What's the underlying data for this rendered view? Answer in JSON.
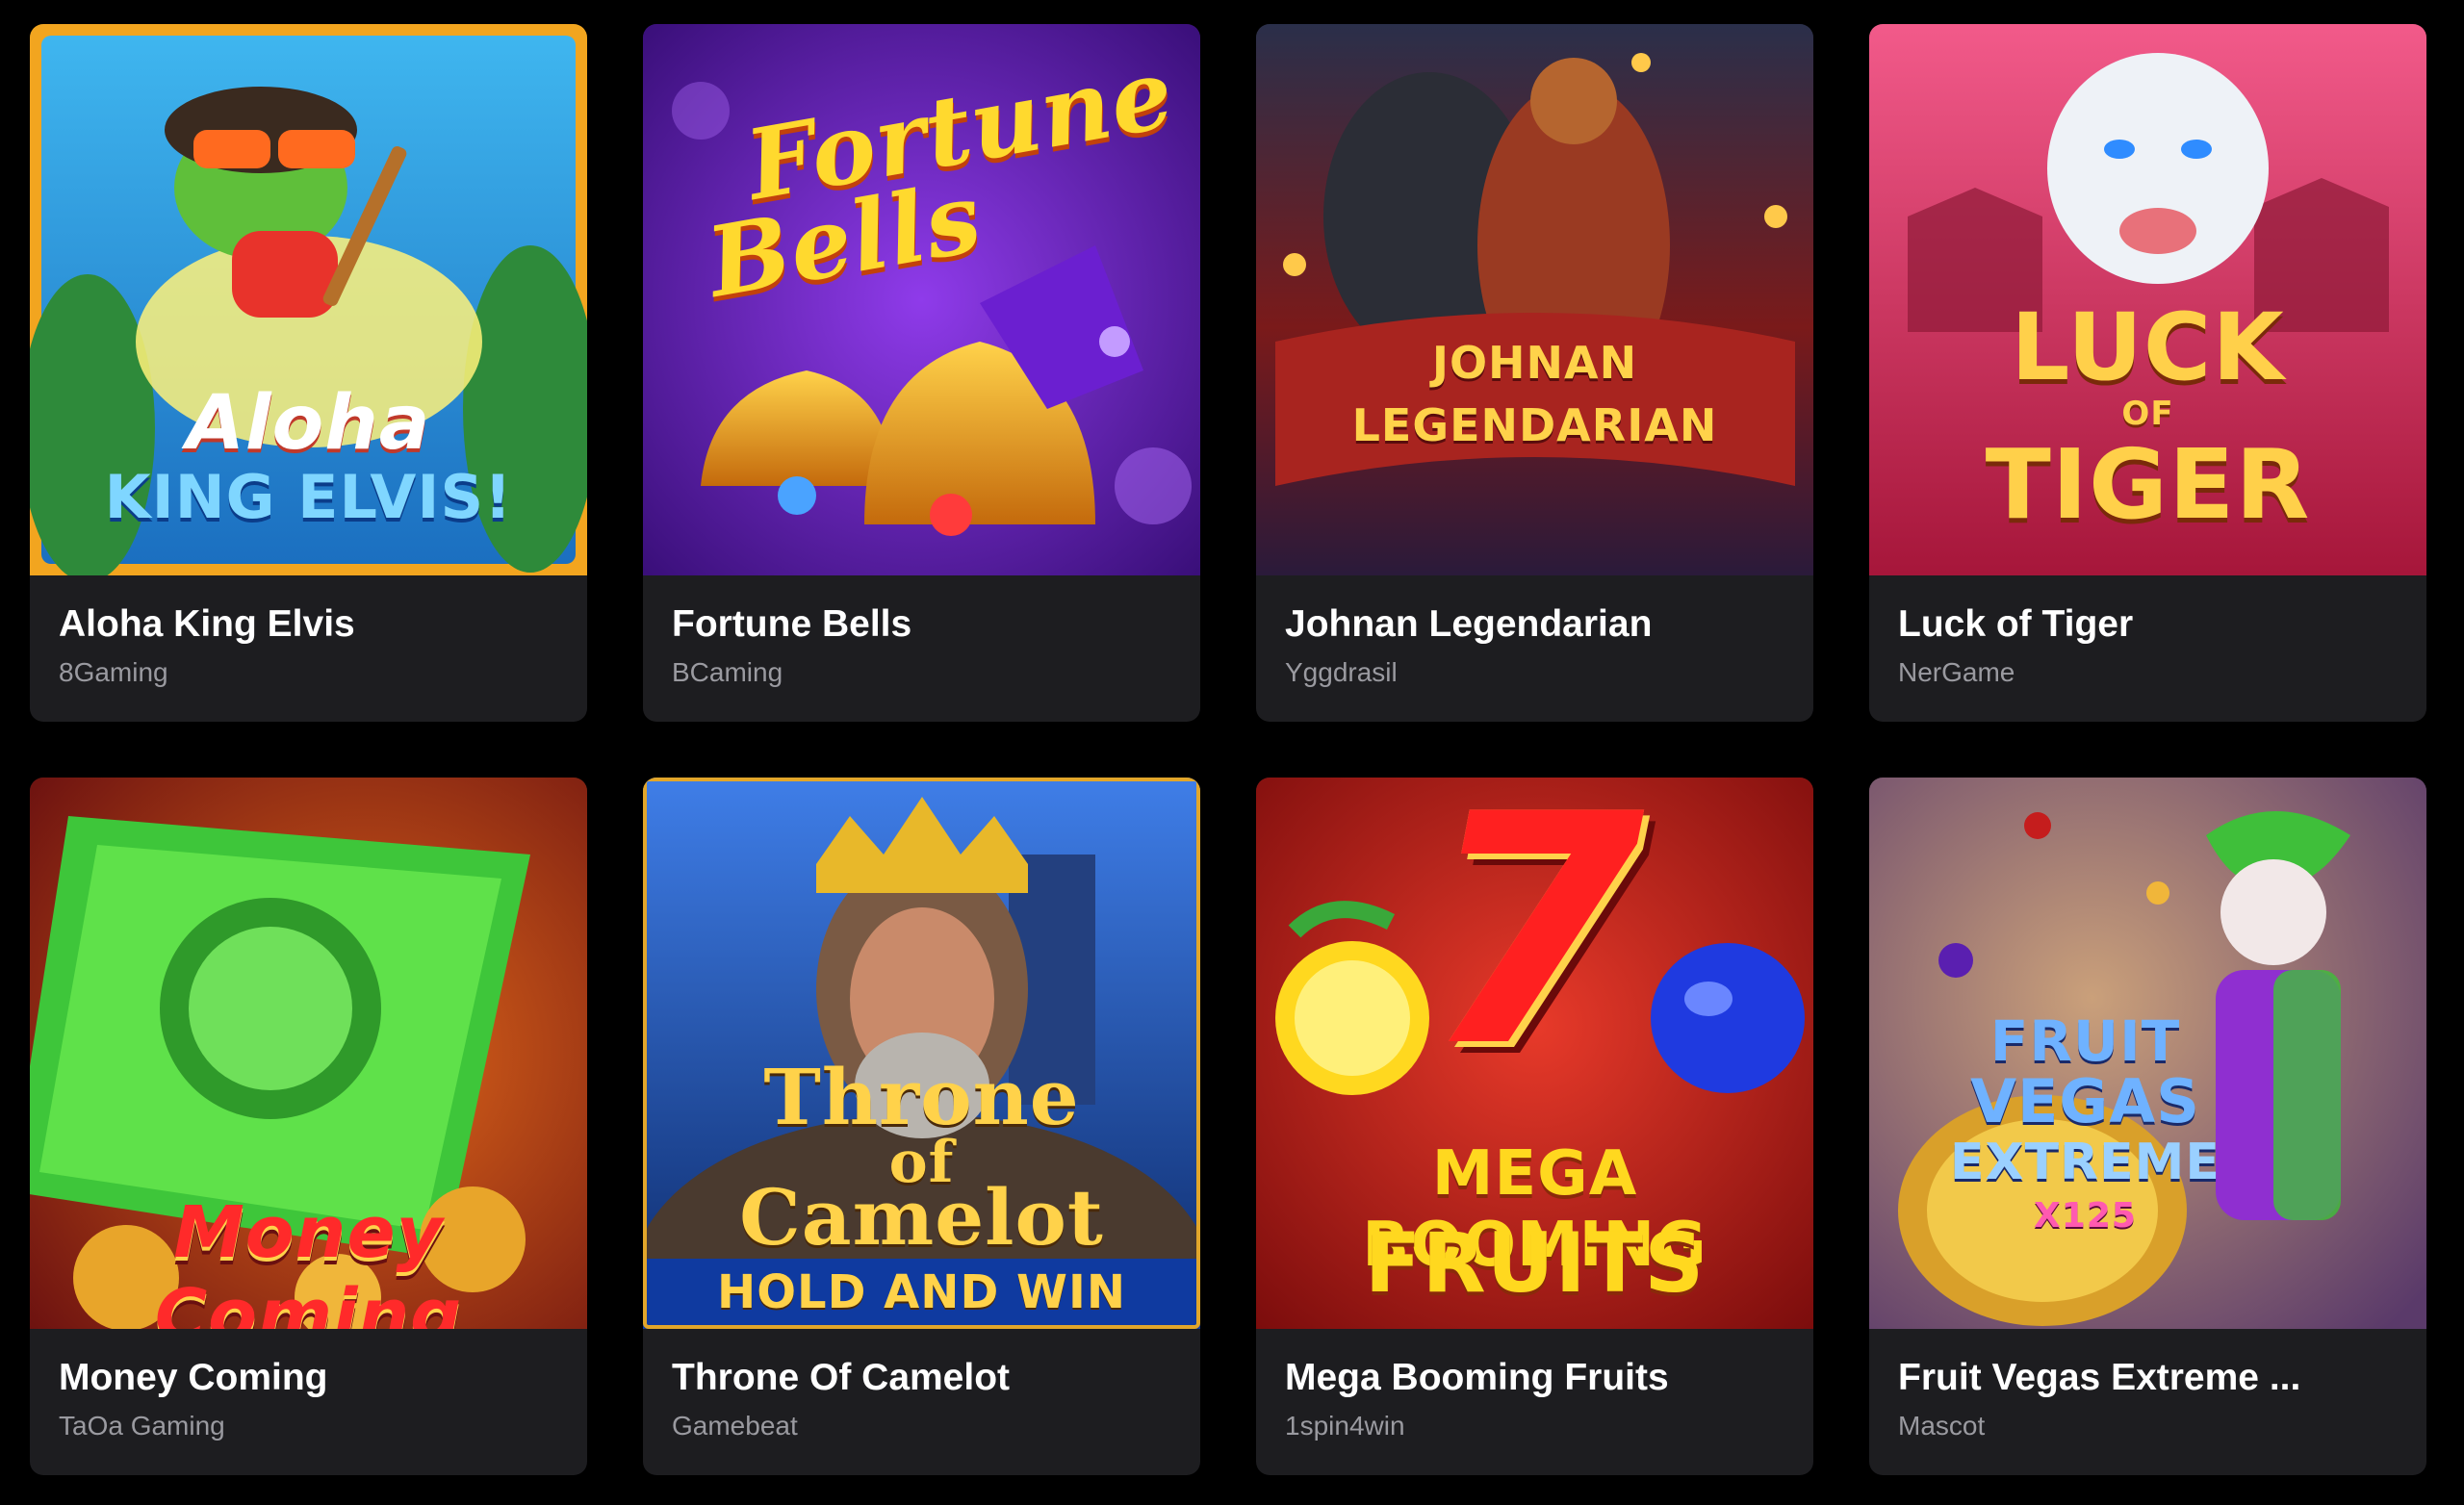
{
  "games": [
    {
      "title": "Aloha King Elvis",
      "provider": "8Gaming",
      "art_line1": "Aloha",
      "art_line2": "KING ELVIS!",
      "accent": "#2fa9e6",
      "icon": "frog-ukulele-icon"
    },
    {
      "title": "Fortune Bells",
      "provider": "BCaming",
      "art_line1": "Fortune",
      "art_line2": "Bells",
      "accent": "#7a2fd6",
      "icon": "bells-icon"
    },
    {
      "title": "Johnan Legendarian",
      "provider": "Yggdrasil",
      "art_line1": "JOHNAN",
      "art_line2": "LEGENDARIAN",
      "accent": "#b3261e",
      "icon": "warrior-icon"
    },
    {
      "title": "Luck of Tiger",
      "provider": "NerGame",
      "art_line1": "LUCK",
      "art_line2": "OF",
      "art_line3": "TIGER",
      "accent": "#d93158",
      "icon": "tiger-icon"
    },
    {
      "title": "Money Coming",
      "provider": "TaOa Gaming",
      "art_line1": "Money Coming",
      "accent": "#2fbf3a",
      "icon": "dollar-bill-icon"
    },
    {
      "title": "Throne Of Camelot",
      "provider": "Gamebeat",
      "art_line1": "Throne",
      "art_line2": "of",
      "art_line3": "Camelot",
      "art_line4": "HOLD AND WIN",
      "accent": "#1f5fd0",
      "icon": "king-icon"
    },
    {
      "title": "Mega Booming Fruits",
      "provider": "1spin4win",
      "art_line1": "7",
      "art_line2": "MEGA BOOMING",
      "art_line3": "FRUITS",
      "accent": "#c51d1d",
      "icon": "lucky-seven-icon"
    },
    {
      "title": "Fruit Vegas Extreme ...",
      "provider": "Mascot",
      "art_line1": "FRUIT",
      "art_line2": "VEGAS",
      "art_line3": "EXTREME",
      "art_line4": "X125",
      "accent": "#8a5fd0",
      "icon": "jester-icon"
    }
  ]
}
